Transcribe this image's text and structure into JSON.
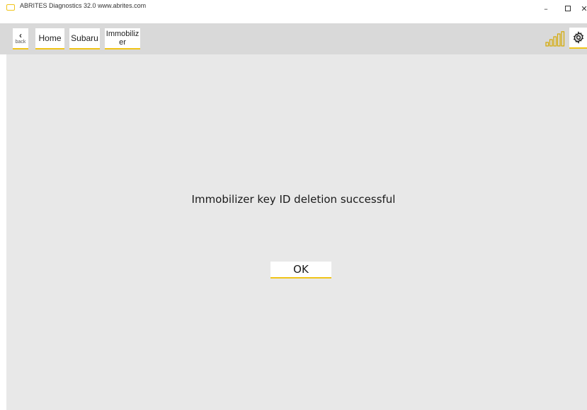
{
  "window": {
    "title": "ABRITES Diagnostics 32.0   www.abrites.com",
    "minimize_glyph": "–",
    "close_glyph": "✕"
  },
  "toolbar": {
    "back_label": "back",
    "back_glyph": "‹",
    "breadcrumbs": [
      "Home",
      "Subaru"
    ],
    "immobilizer_line1": "Immobiliz",
    "immobilizer_line2": "er",
    "signal_icon": "signal-strength-icon",
    "settings_icon": "gear-icon"
  },
  "dialog": {
    "message": "Immobilizer key ID deletion successful",
    "ok_label": "OK"
  },
  "colors": {
    "accent": "#f0c419",
    "toolbar_bg": "#d9d9d9",
    "content_bg": "#e8e8e8"
  }
}
